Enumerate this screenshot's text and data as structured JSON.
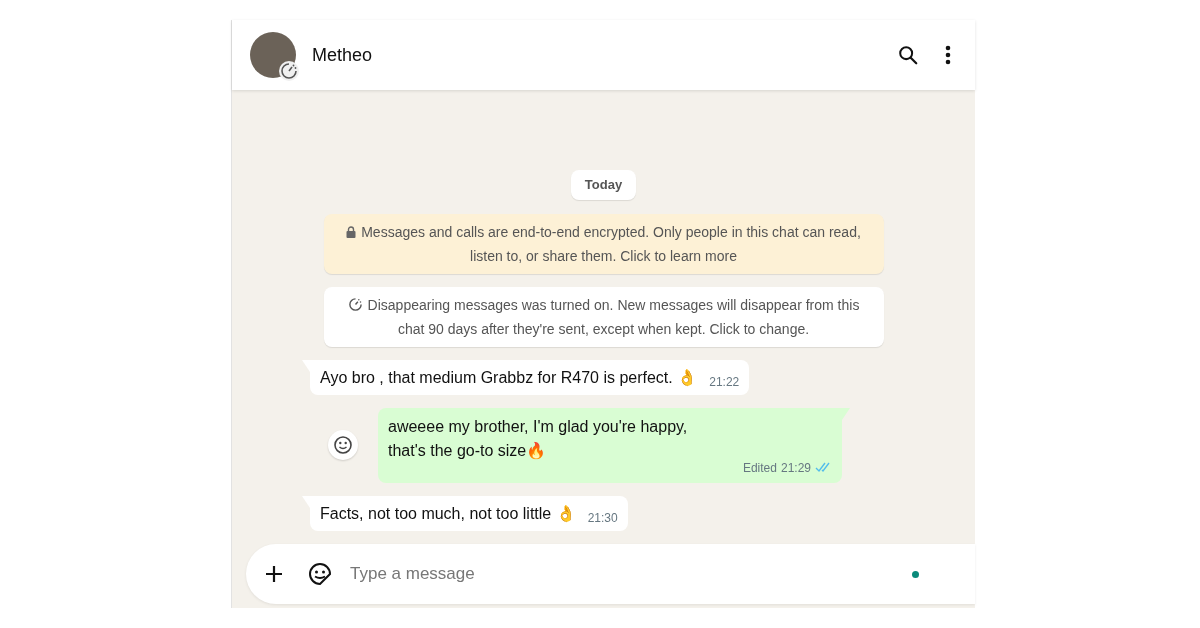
{
  "header": {
    "contact_name": "Metheo"
  },
  "date_chip": "Today",
  "notices": [
    {
      "kind": "encryption",
      "text": "Messages and calls are end-to-end encrypted. Only people in this chat can read, listen to, or share them. Click to learn more"
    },
    {
      "kind": "disappearing",
      "text": "Disappearing messages was turned on. New messages will disappear from this chat 90 days after they're sent, except when kept. Click to change."
    }
  ],
  "messages": [
    {
      "kind": "incoming",
      "text": "Ayo bro , that medium Grabbz for R470 is perfect. 👌",
      "time": "21:22"
    },
    {
      "kind": "outgoing",
      "text": "aweeee my brother, I'm glad you're happy,\nthat's the go-to size🔥",
      "edited": "Edited",
      "time": "21:29",
      "read": true
    },
    {
      "kind": "incoming",
      "text": "Facts, not too much, not too little 👌",
      "time": "21:30"
    }
  ],
  "composer": {
    "placeholder": "Type a message"
  }
}
